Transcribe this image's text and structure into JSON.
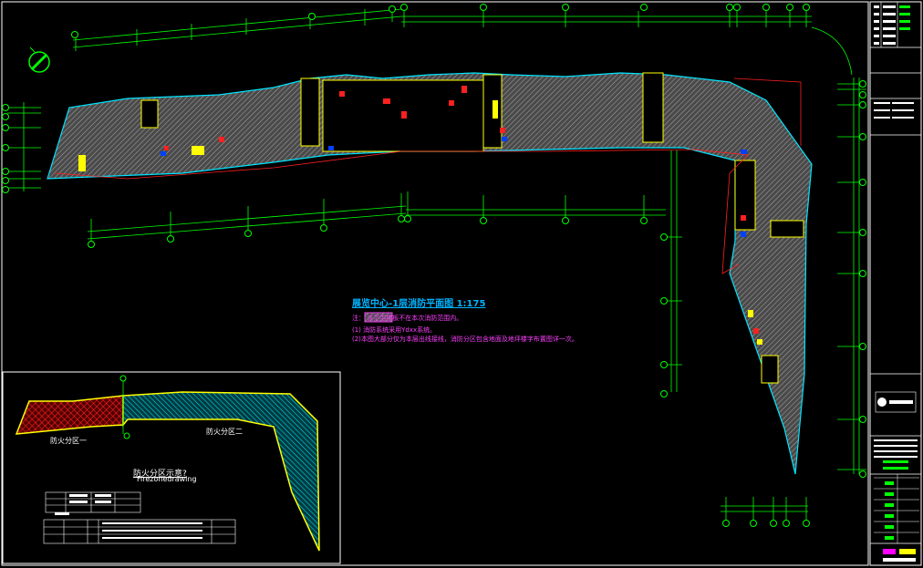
{
  "drawing": {
    "plan_title": "展览中心-1层消防平面图 1:175",
    "note_lines": [
      "注：          该范围楼板不在本次消防范围内。",
      "(1) 消防系统采用Ydxx系统。",
      "(2)本图大部分仅为本层出线接线，消防分区包含地面及地坪楼字布置图详一次。"
    ],
    "inset": {
      "zone_one": "防火分区一",
      "zone_two": "防火分区二",
      "title": "防火分区示意?",
      "subtitle": "Firezonedrawing"
    }
  },
  "colors": {
    "background": "#000000",
    "grid_line": "#00ff00",
    "building_outline": "#00e5ff",
    "zone_one_fill": "#c00000",
    "zone_two_fill": "#00c8d8",
    "zone_border": "#ffff00",
    "title_text": "#00b4ff",
    "note_text": "#ff40ff",
    "hatch": "#9a9a9a"
  }
}
